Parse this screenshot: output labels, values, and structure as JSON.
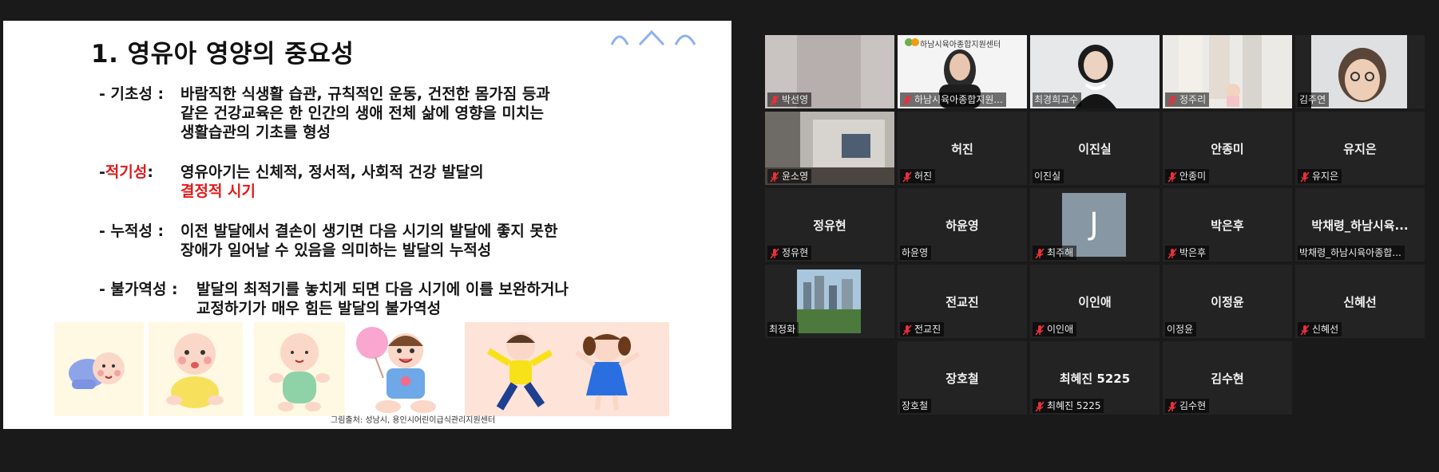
{
  "slide": {
    "title": "1. 영유아 영양의 중요성",
    "bullets": [
      {
        "term": "- 기초성 :",
        "term_red": false,
        "lines": [
          "바람직한 식생활 습관, 규칙적인 운동, 건전한 몸가짐 등과",
          "같은 건강교육은 한 인간의 생애 전체 삶에 영향을 미치는",
          "생활습관의 기초를 형성"
        ]
      },
      {
        "term": "적기성",
        "term_red": true,
        "term_prefix": "- ",
        "term_suffix": " :",
        "lines": [
          "영유아기는 신체적, 정서적, 사회적 건강 발달의"
        ],
        "red_line": "결정적 시기"
      },
      {
        "term": "- 누적성 :",
        "term_red": false,
        "lines": [
          "이전 발달에서 결손이 생기면 다음 시기의 발달에 좋지 못한",
          "장애가 일어날 수 있음을 의미하는 발달의 누적성"
        ]
      },
      {
        "term": "- 불가역성 :",
        "term_red": false,
        "lines": [
          "발달의 최적기를 놓치게 되면 다음 시기에 이를 보완하거나",
          "교정하기가 매우 힘든 발달의 불가역성"
        ]
      }
    ],
    "credit": "그림출처: 성남시, 용인시어린이급식관리지원센터"
  },
  "participants": [
    {
      "name": "박선영",
      "label": "박선영",
      "muted": true,
      "video": "blurred"
    },
    {
      "name": "하남시육아종합지원...",
      "label": "하남시육아종합지원...",
      "muted": true,
      "video": "woman-logo",
      "logo_text": "하남시육아종합지원센터"
    },
    {
      "name": "최경희교수",
      "label": "최경희교수",
      "muted": false,
      "video": "speaker",
      "active": true
    },
    {
      "name": "정주리",
      "label": "정주리",
      "muted": true,
      "video": "family"
    },
    {
      "name": "김주연",
      "label": "김주연",
      "muted": false,
      "video": "woman-glasses"
    },
    {
      "name": "윤소영",
      "label": "윤소영",
      "muted": true,
      "video": "room"
    },
    {
      "name": "허진",
      "label": "허진",
      "muted": true,
      "video": "none"
    },
    {
      "name": "이진실",
      "label": "이진실",
      "muted": false,
      "video": "none"
    },
    {
      "name": "안종미",
      "label": "안종미",
      "muted": true,
      "video": "none"
    },
    {
      "name": "유지은",
      "label": "유지은",
      "muted": true,
      "video": "none"
    },
    {
      "name": "정유현",
      "label": "정유현",
      "muted": true,
      "video": "none"
    },
    {
      "name": "하윤영",
      "label": "하윤영",
      "muted": false,
      "video": "none"
    },
    {
      "name": "J",
      "label": "최주해",
      "muted": true,
      "video": "avatar"
    },
    {
      "name": "박은후",
      "label": "박은후",
      "muted": true,
      "video": "none"
    },
    {
      "name": "박채령_하남시육...",
      "label": "박채령_하남시육아종합...",
      "muted": false,
      "video": "none"
    },
    {
      "name": "최정화",
      "label": "최정화",
      "muted": false,
      "video": "city"
    },
    {
      "name": "전교진",
      "label": "전교진",
      "muted": true,
      "video": "none"
    },
    {
      "name": "이인애",
      "label": "이인애",
      "muted": true,
      "video": "none"
    },
    {
      "name": "이정윤",
      "label": "이정윤",
      "muted": false,
      "video": "none"
    },
    {
      "name": "신혜선",
      "label": "신혜선",
      "muted": true,
      "video": "none"
    },
    {
      "name": "장호철",
      "label": "장호철",
      "muted": false,
      "video": "none"
    },
    {
      "name": "최혜진 5225",
      "label": "최혜진 5225",
      "muted": true,
      "video": "none"
    },
    {
      "name": "김수현",
      "label": "김수현",
      "muted": true,
      "video": "none"
    }
  ],
  "colors": {
    "background": "#1a1a1a",
    "tile": "#232323",
    "active_border": "#a9e05a",
    "muted_mic": "#e8303a",
    "accent_red": "#e21a1a"
  }
}
